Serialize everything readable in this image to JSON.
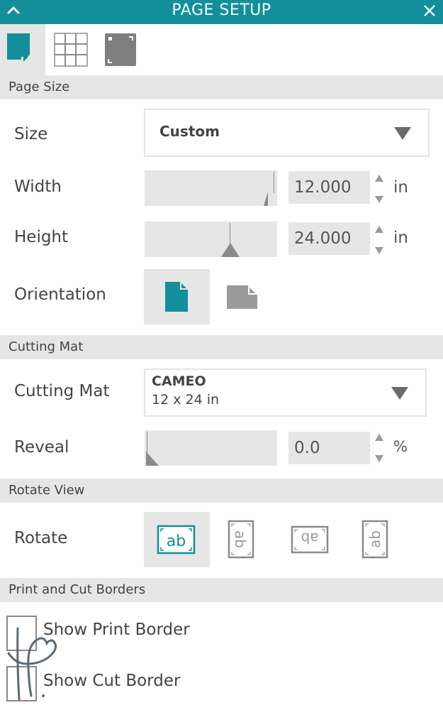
{
  "window": {
    "title": "PAGE SETUP",
    "collapse_icon": "chevron-up-icon",
    "close_icon": "close-icon",
    "accent_color": "#138f9b"
  },
  "tabs": [
    {
      "name": "page-setup",
      "icon": "page-icon",
      "active": true
    },
    {
      "name": "grid",
      "icon": "grid-icon",
      "active": false
    },
    {
      "name": "registration-marks",
      "icon": "registration-icon",
      "active": false
    }
  ],
  "page_size": {
    "header": "Page Size",
    "size_label": "Size",
    "size_value": "Custom",
    "width_label": "Width",
    "width_value": "12.000",
    "width_unit": "in",
    "width_slider_fraction": 1.0,
    "height_label": "Height",
    "height_value": "24.000",
    "height_unit": "in",
    "height_slider_fraction": 0.65,
    "orientation_label": "Orientation",
    "orientation_options": [
      "portrait",
      "landscape"
    ],
    "orientation_selected": "portrait"
  },
  "cutting_mat": {
    "header": "Cutting Mat",
    "mat_label": "Cutting Mat",
    "mat_value_line1": "CAMEO",
    "mat_value_line2": "12 x 24 in",
    "reveal_label": "Reveal",
    "reveal_value": "0.0",
    "reveal_unit": "%",
    "reveal_slider_fraction": 0.0
  },
  "rotate_view": {
    "header": "Rotate View",
    "rotate_label": "Rotate",
    "options": [
      {
        "name": "rotate-0",
        "glyph": "ab",
        "selected": true
      },
      {
        "name": "rotate-90",
        "glyph": "ab",
        "selected": false
      },
      {
        "name": "rotate-180",
        "glyph": "ab",
        "selected": false
      },
      {
        "name": "rotate-270",
        "glyph": "ab",
        "selected": false
      }
    ]
  },
  "borders": {
    "header": "Print and Cut Borders",
    "show_print_border": {
      "label": "Show Print Border",
      "checked": false
    },
    "show_cut_border": {
      "label": "Show Cut Border",
      "checked": false
    }
  }
}
